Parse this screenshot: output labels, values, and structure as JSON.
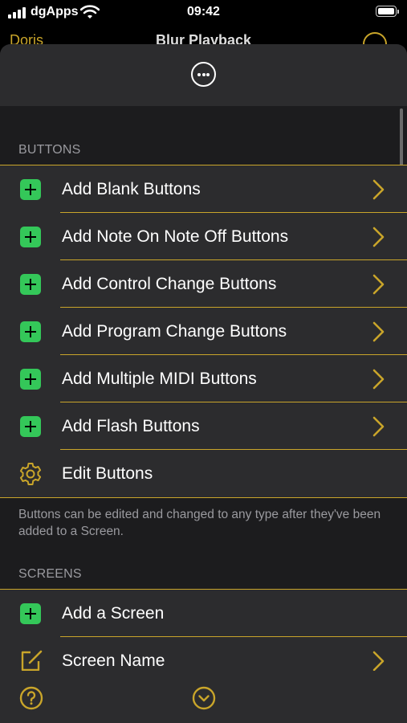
{
  "status_bar": {
    "carrier": "dgApps",
    "time": "09:42"
  },
  "background_nav": {
    "back_label": "Doris",
    "title": "Blur Playback"
  },
  "colors": {
    "accent": "#c9a52a",
    "green": "#34c759",
    "sheet_bg": "#1c1c1e",
    "row_bg": "#2c2c2e",
    "secondary_text": "#9a9a9f"
  },
  "header": {
    "more_icon": "ellipsis-circle-icon"
  },
  "buttons_section": {
    "header": "BUTTONS",
    "items": [
      {
        "label": "Add Blank Buttons",
        "icon": "plus-square-icon",
        "has_chevron": true
      },
      {
        "label": "Add Note On Note Off Buttons",
        "icon": "plus-square-icon",
        "has_chevron": true
      },
      {
        "label": "Add Control Change Buttons",
        "icon": "plus-square-icon",
        "has_chevron": true
      },
      {
        "label": "Add Program Change Buttons",
        "icon": "plus-square-icon",
        "has_chevron": true
      },
      {
        "label": "Add Multiple MIDI Buttons",
        "icon": "plus-square-icon",
        "has_chevron": true
      },
      {
        "label": "Add Flash Buttons",
        "icon": "plus-square-icon",
        "has_chevron": true
      },
      {
        "label": "Edit Buttons",
        "icon": "gear-icon",
        "has_chevron": false
      }
    ],
    "footer": "Buttons can be edited and changed to any type after they've been added to a Screen."
  },
  "screens_section": {
    "header": "SCREENS",
    "items": [
      {
        "label": "Add a Screen",
        "icon": "plus-square-icon",
        "has_chevron": false
      },
      {
        "label": "Screen Name",
        "icon": "pencil-square-icon",
        "has_chevron": true
      }
    ]
  },
  "toolbar": {
    "left_icon": "help-circle-icon",
    "center_icon": "chevron-down-circle-icon"
  }
}
